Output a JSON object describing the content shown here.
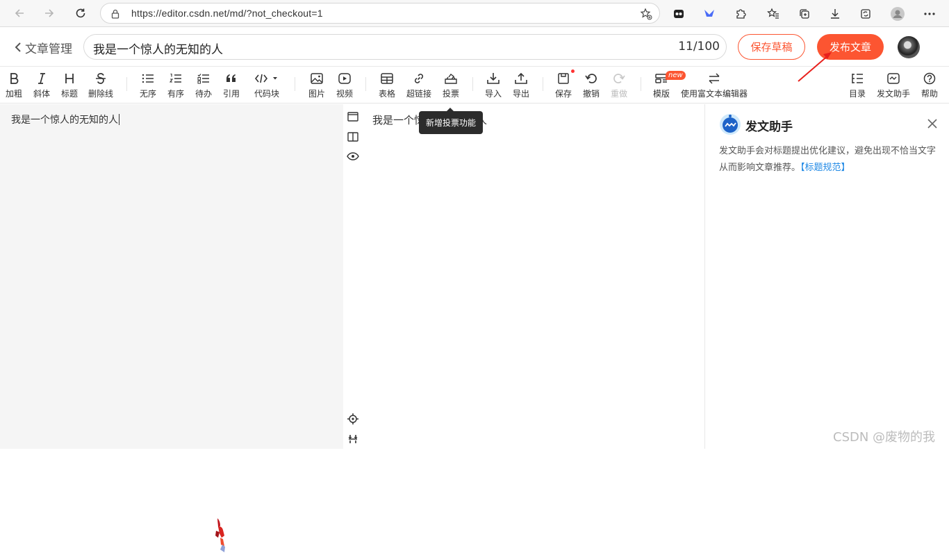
{
  "browser": {
    "url": "https://editor.csdn.net/md/?not_checkout=1"
  },
  "header": {
    "back_label": "文章管理",
    "title_value": "我是一个惊人的无知的人",
    "title_count": "11/100",
    "save_draft": "保存草稿",
    "publish": "发布文章"
  },
  "toolbar": {
    "bold": "加粗",
    "italic": "斜体",
    "heading": "标题",
    "strike": "删除线",
    "unordered": "无序",
    "ordered": "有序",
    "todo": "待办",
    "quote": "引用",
    "codeblock": "代码块",
    "image": "图片",
    "video": "视频",
    "table": "表格",
    "link": "超链接",
    "vote": "投票",
    "import": "导入",
    "export": "导出",
    "save": "保存",
    "undo": "撤销",
    "redo": "重做",
    "template": "模版",
    "template_badge": "new",
    "rich_editor": "使用富文本编辑器",
    "toc": "目录",
    "assistant": "发文助手",
    "help": "帮助"
  },
  "editor": {
    "content": "我是一个惊人的无知的人"
  },
  "preview": {
    "content": "我是一个惊人的无知的人"
  },
  "tooltip": {
    "text": "新增投票功能"
  },
  "assistant": {
    "title": "发文助手",
    "description": "发文助手会对标题提出优化建议，避免出现不恰当文字从而影响文章推荐。",
    "link": "【标题规范】"
  },
  "watermark": "CSDN @废物的我",
  "colors": {
    "accent": "#fc5531",
    "link": "#1e88e5",
    "editor_bg": "#f5f5f5"
  }
}
